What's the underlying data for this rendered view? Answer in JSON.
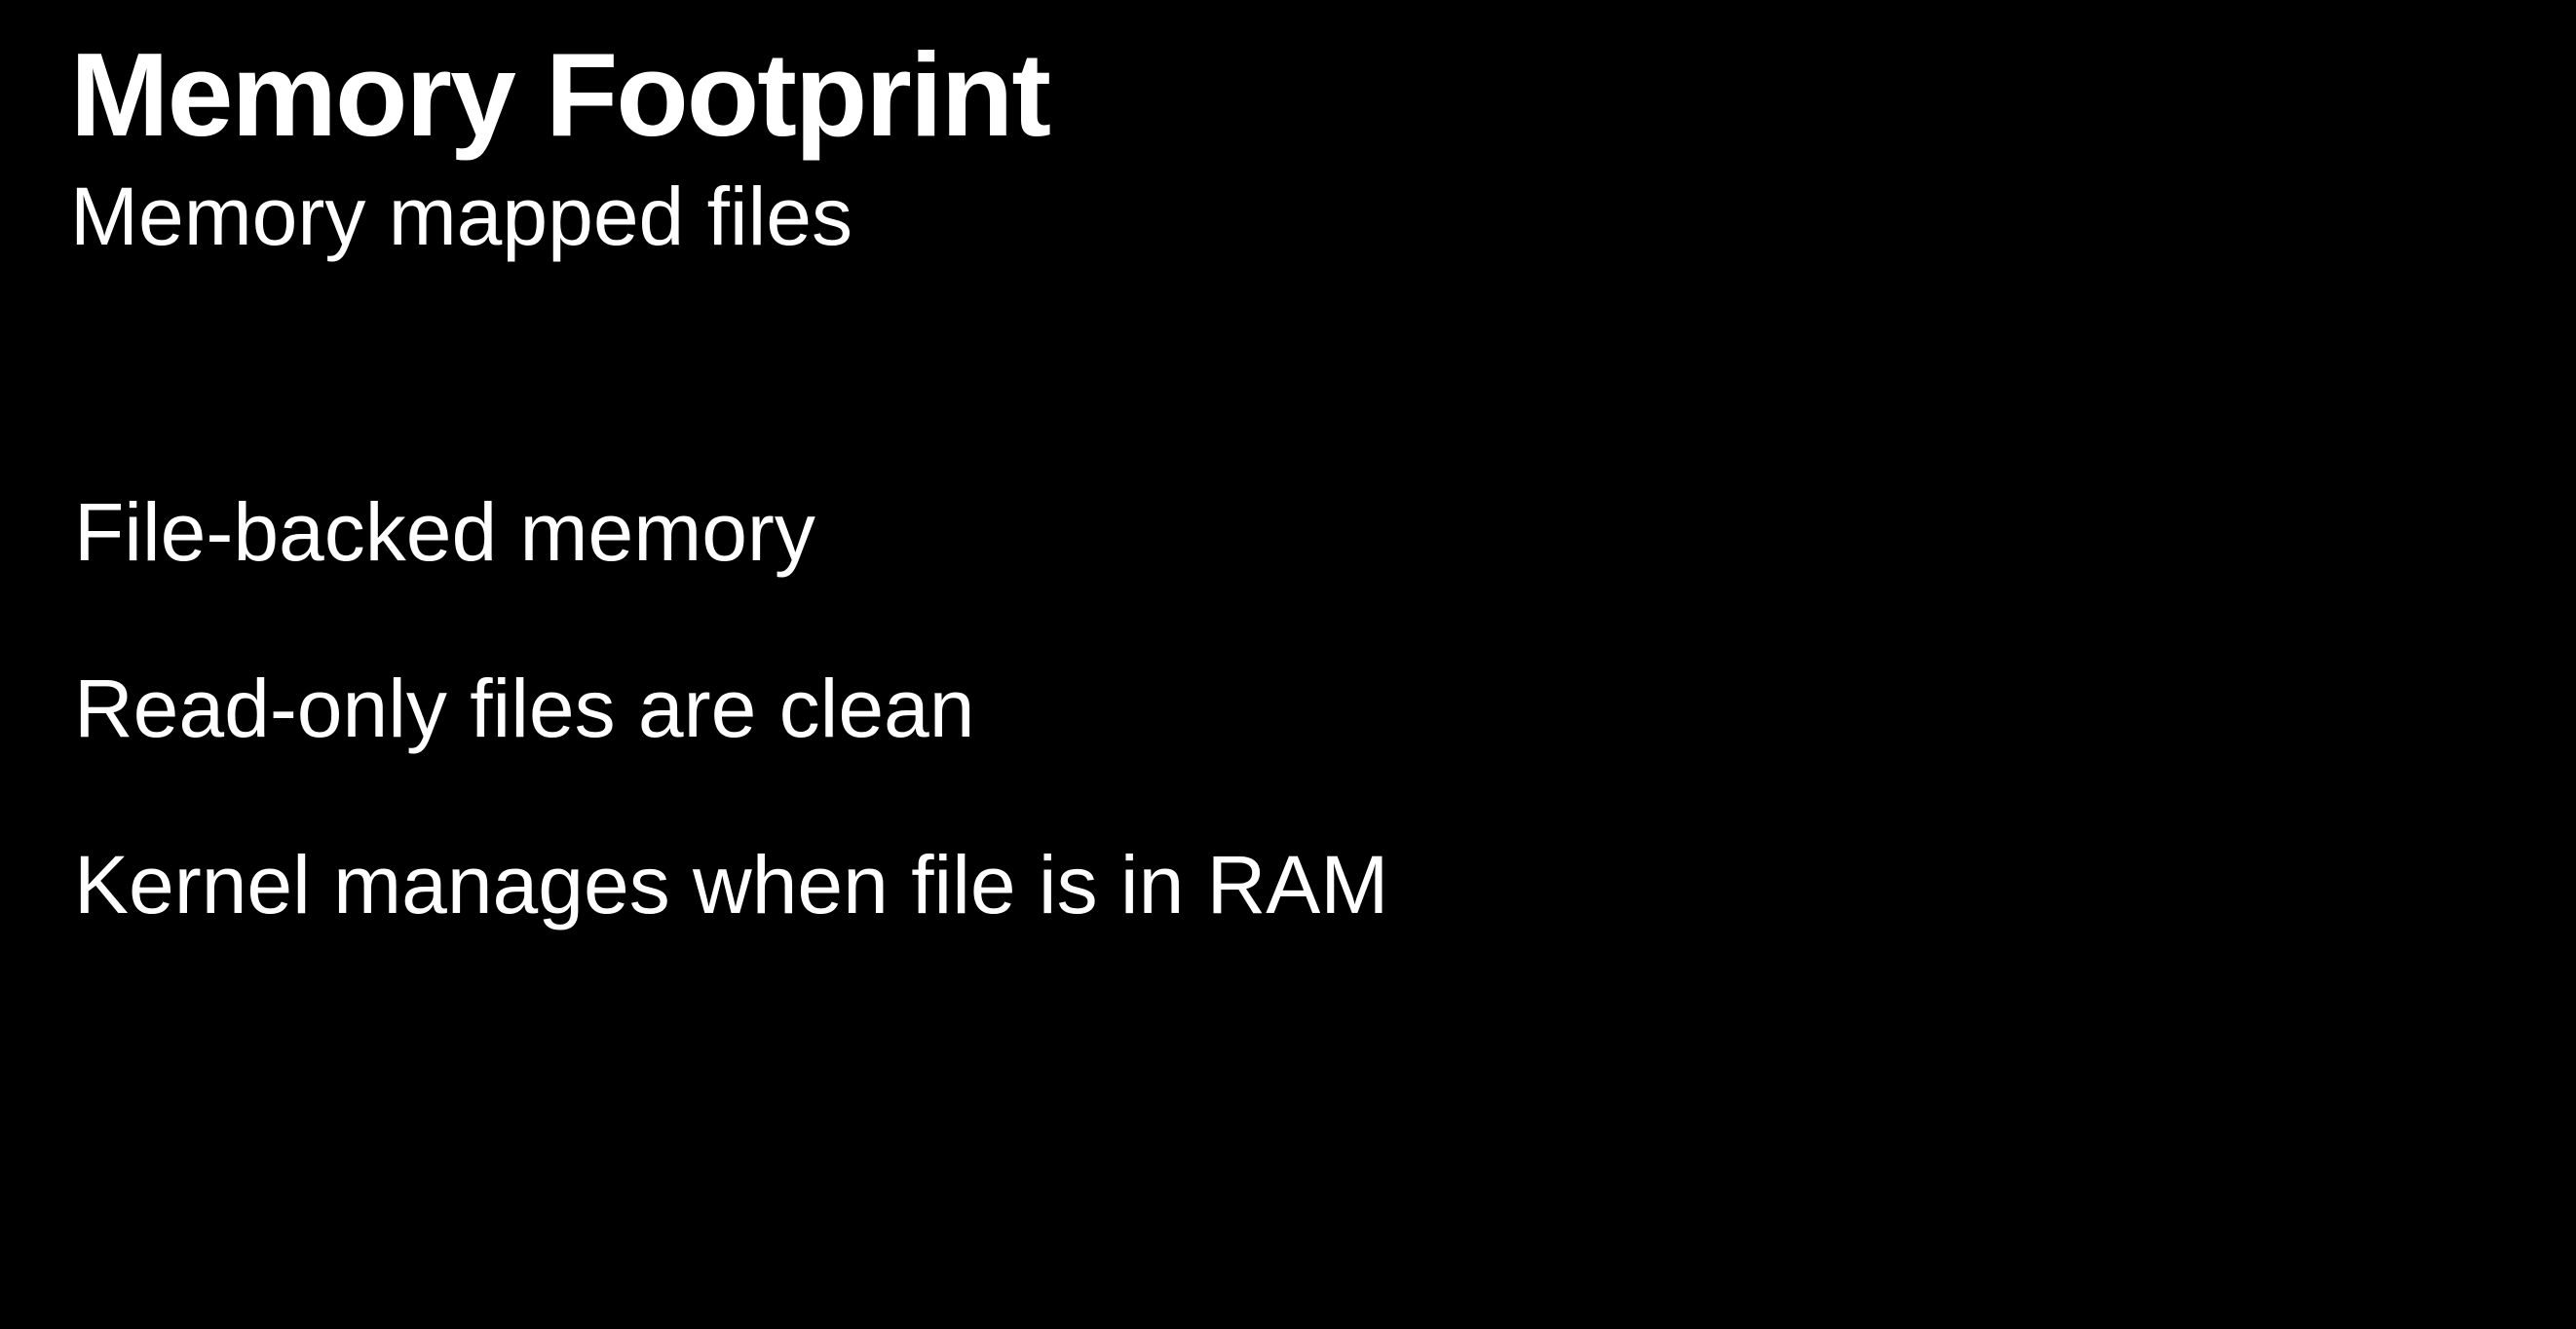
{
  "slide": {
    "title": "Memory Footprint",
    "subtitle": "Memory mapped files",
    "bullets": [
      "File-backed memory",
      "Read-only files are clean",
      "Kernel manages when file is in RAM"
    ],
    "colors": {
      "background": "#000000",
      "text": "#ffffff"
    }
  }
}
